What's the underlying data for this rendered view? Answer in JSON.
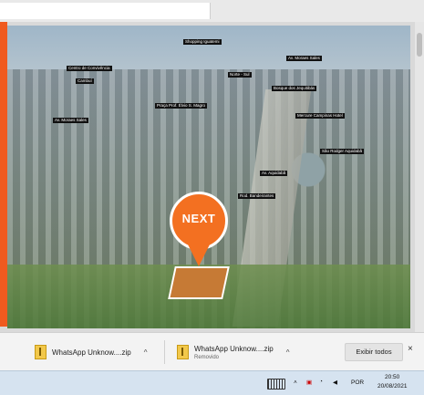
{
  "photo": {
    "logo": "NEXT",
    "labels": [
      "Shopping Iguatemi",
      "Av. Moraes Sales",
      "Centro de Convivência",
      "Cambuí",
      "Norte - Sul",
      "Bosque dos Jequitibás",
      "Praça Prof. Élvio S. Magro",
      "Av. Moraes Sales",
      "Mercure Campinas Hotel",
      "Av. Aquidabã",
      "Rod. Bandeirantes",
      "São Rodger Aquidabã"
    ]
  },
  "downloads": {
    "items": [
      {
        "name": "WhatsApp Unknow....zip",
        "status": ""
      },
      {
        "name": "WhatsApp Unknow....zip",
        "status": "Removido"
      }
    ],
    "show_all": "Exibir todos",
    "close": "×"
  },
  "taskbar": {
    "lang": "POR",
    "time": "20:50",
    "date": "20/08/2021"
  }
}
